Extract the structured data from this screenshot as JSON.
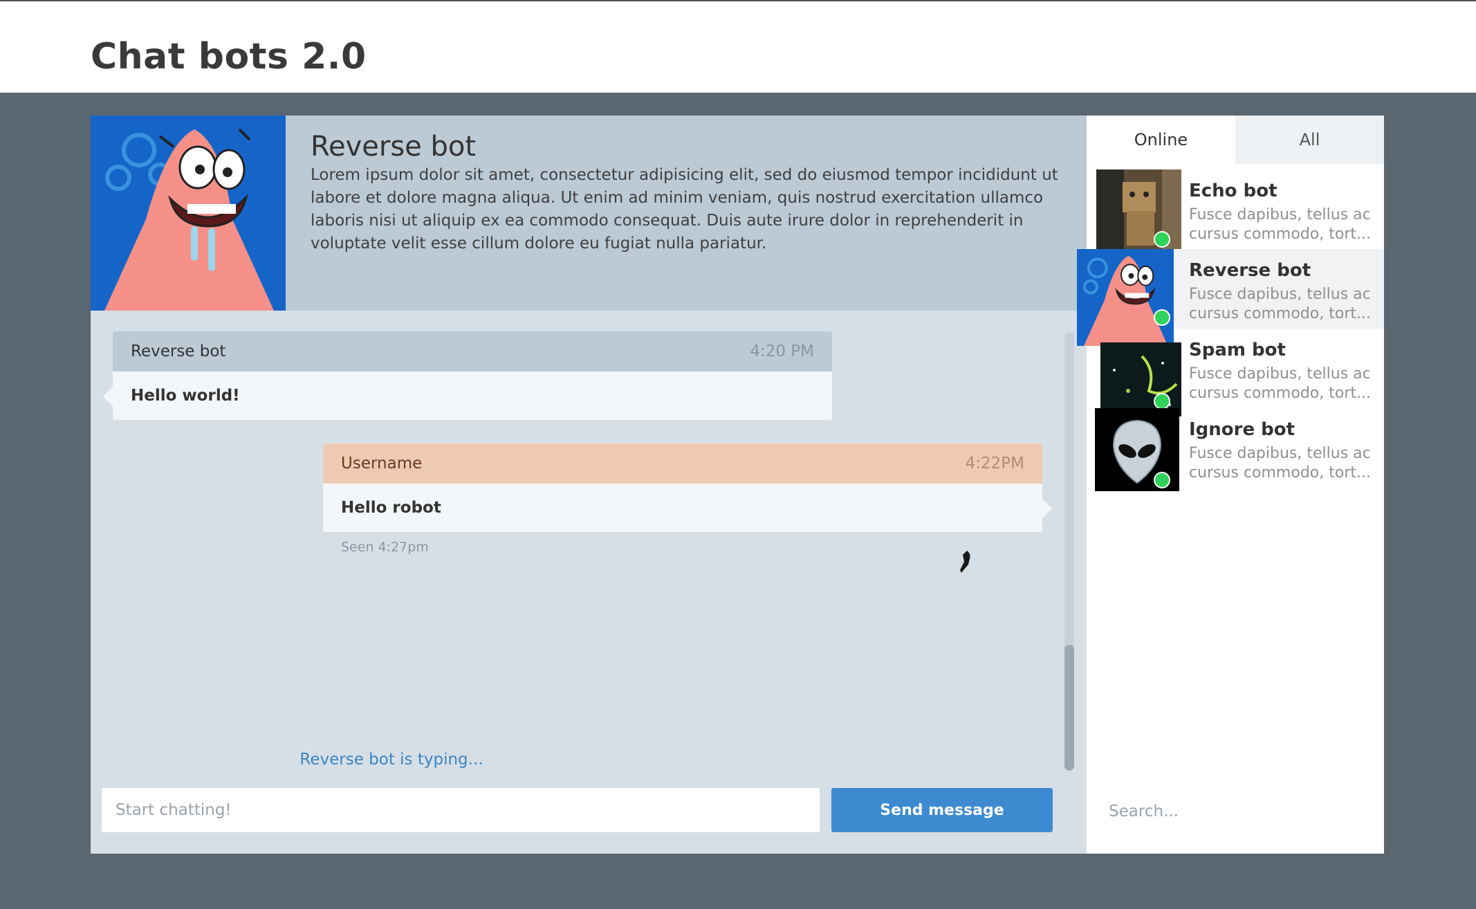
{
  "app": {
    "title": "Chat bots 2.0"
  },
  "bot_header": {
    "name": "Reverse bot",
    "description": "Lorem ipsum dolor sit amet, consectetur adipisicing elit, sed do eiusmod tempor incididunt ut labore et dolore magna aliqua. Ut enim ad minim veniam, quis nostrud exercitation ullamco laboris nisi ut aliquip ex ea commodo consequat. Duis aute irure dolor in reprehenderit in voluptate velit esse cillum dolore eu fugiat nulla pariatur.",
    "avatar_icon": "starfish-avatar"
  },
  "messages": [
    {
      "sender": "Reverse bot",
      "time": "4:20 PM",
      "text": "Hello world!"
    },
    {
      "sender": "Username",
      "time": "4:22PM",
      "text": "Hello robot",
      "seen": "Seen 4:27pm"
    }
  ],
  "typing_indicator": "Reverse bot is typing...",
  "composer": {
    "placeholder": "Start chatting!",
    "send_label": "Send message"
  },
  "sidebar": {
    "tabs": [
      {
        "label": "Online",
        "active": true
      },
      {
        "label": "All",
        "active": false
      }
    ],
    "contacts": [
      {
        "name": "Echo bot",
        "preview": "Fusce dapibus, tellus ac cursus commodo, tort...",
        "avatar_icon": "cardboard-robot-avatar",
        "status": "online"
      },
      {
        "name": "Reverse bot",
        "preview": "Fusce dapibus, tellus ac cursus commodo, tort...",
        "avatar_icon": "starfish-avatar",
        "status": "online",
        "selected": true
      },
      {
        "name": "Spam bot",
        "preview": "Fusce dapibus, tellus ac cursus commodo, tort...",
        "avatar_icon": "dark-space-avatar",
        "status": "online"
      },
      {
        "name": "Ignore bot",
        "preview": "Fusce dapibus, tellus ac cursus commodo, tort...",
        "avatar_icon": "alien-head-avatar",
        "status": "online"
      }
    ],
    "search_placeholder": "Search..."
  },
  "colors": {
    "accent": "#3e8ad0",
    "online": "#2fd35a",
    "bot_bubble_header": "#bccad6",
    "user_bubble_header": "#efcab2"
  }
}
